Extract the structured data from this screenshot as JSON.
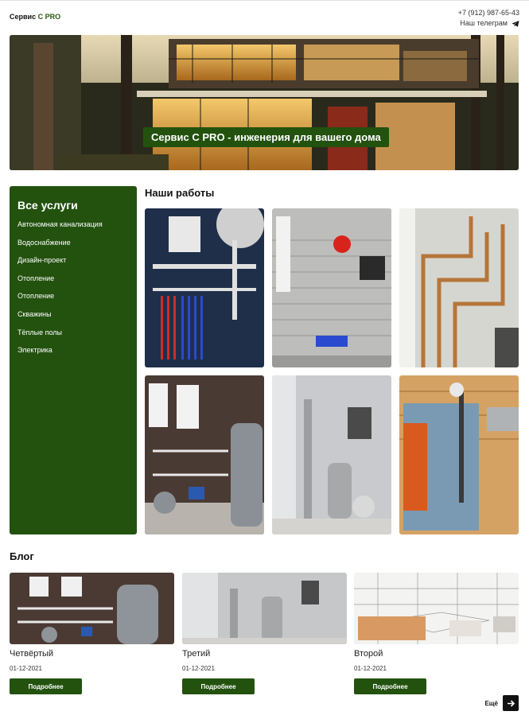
{
  "header": {
    "logo_prefix": "Сервис ",
    "logo_accent": "C PRO",
    "phone": "+7 (912) 987-65-43",
    "telegram_label": "Наш телеграм",
    "telegram_icon": "telegram-icon"
  },
  "hero": {
    "title": "Сервис C PRO - инженерия для вашего дома"
  },
  "sidebar": {
    "title": "Все услуги",
    "items": [
      {
        "label": "Автономная канализация"
      },
      {
        "label": "Водоснабжение"
      },
      {
        "label": "Дизайн-проект"
      },
      {
        "label": "Отопление"
      },
      {
        "label": "Отопление"
      },
      {
        "label": "Скважины"
      },
      {
        "label": "Тёплые полы"
      },
      {
        "label": "Электрика"
      }
    ]
  },
  "works": {
    "title": "Наши работы",
    "photos": [
      "boiler-room-photo-1",
      "boiler-room-photo-2",
      "boiler-room-photo-3",
      "boiler-room-photo-4",
      "boiler-room-photo-5",
      "boiler-room-photo-6"
    ]
  },
  "blog": {
    "title": "Блог",
    "posts": [
      {
        "title": "Четвёртый",
        "date": "01-12-2021",
        "button": "Подробнее"
      },
      {
        "title": "Третий",
        "date": "01-12-2021",
        "button": "Подробнее"
      },
      {
        "title": "Второй",
        "date": "01-12-2021",
        "button": "Подробнее"
      }
    ],
    "more_label": "Ещё",
    "more_icon": "arrow-right-icon"
  },
  "colors": {
    "brand_green": "#23520f",
    "text": "#111111"
  }
}
